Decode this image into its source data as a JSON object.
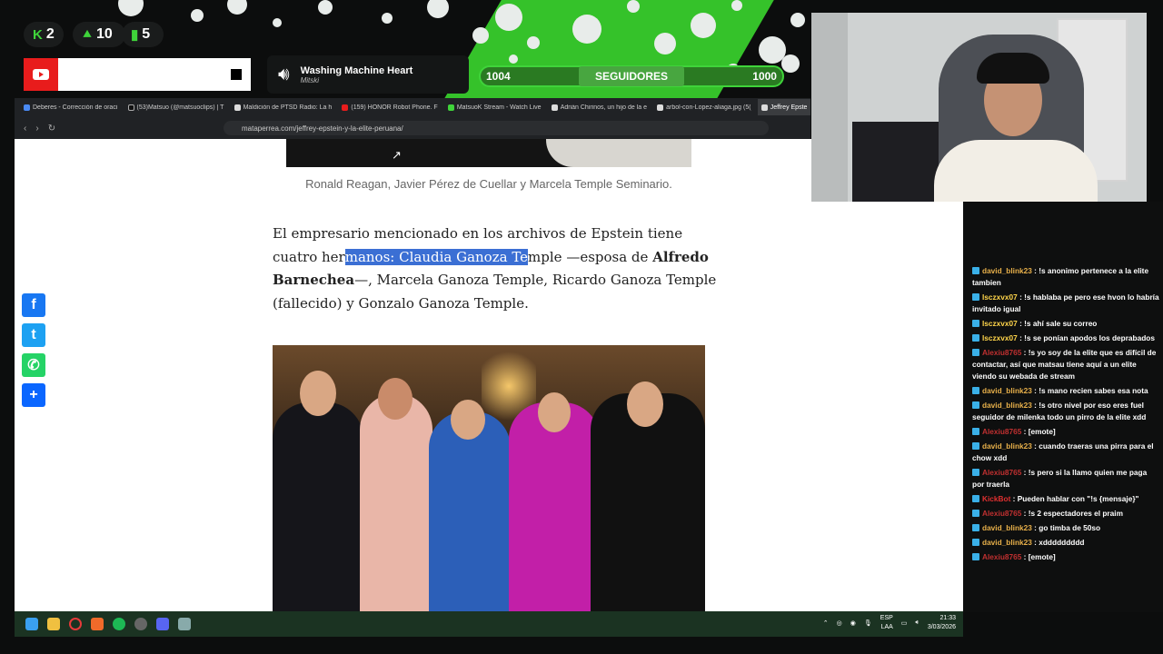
{
  "overlay": {
    "stats": [
      {
        "icon": "kick-icon",
        "value": "2"
      },
      {
        "icon": "follower-icon",
        "value": "10"
      },
      {
        "icon": "bars-icon",
        "value": "5"
      }
    ],
    "music": {
      "title": "Washing Machine Heart",
      "artist": "Mitski"
    },
    "followers": {
      "left": "1004",
      "label": "SEGUIDORES",
      "right": "1000"
    }
  },
  "browser": {
    "tabs": [
      "Deberes - Corrección de oraci",
      "(53)Matsuo (@matsuoclips) | T",
      "Maldición de PTSD Radio: La h",
      "(159) HONOR Robot Phone. F",
      "MatsuoK Stream - Watch Live",
      "Adrián Chirinos, un hijo de la e",
      "arbol-con-Lopez-aliaga.jpg (5(",
      "Jeffrey Epste"
    ],
    "url": "mataperrea.com/jeffrey-epstein-y-la-elite-peruana/"
  },
  "article": {
    "caption": "Ronald Reagan, Javier Pérez de Cuellar y Marcela Temple Seminario.",
    "p1": "El empresario mencionado en los archivos de Epstein tiene cuatro her",
    "p_hl": "manos: Claudia Ganoza Te",
    "p2": "mple —esposa de ",
    "p_bold": "Alfredo Barnechea",
    "p3": "—, Marcela Ganoza Temple, Ricardo Ganoza Temple (fallecido) y Gonzalo Ganoza Temple."
  },
  "chat": [
    {
      "user": "david_blink23",
      "cls": "u1",
      "text": "!s anonimo pertenece a la elite tambien"
    },
    {
      "user": "lsczxvx07",
      "cls": "u2",
      "text": "!s hablaba pe pero ese hvon lo habría invitado igual"
    },
    {
      "user": "lsczxvx07",
      "cls": "u2",
      "text": "!s ahí sale su correo"
    },
    {
      "user": "lsczxvx07",
      "cls": "u2",
      "text": "!s se ponían apodos los deprabados"
    },
    {
      "user": "Alexiu8765",
      "cls": "u3",
      "text": "!s yo soy de la elite que es difícil de contactar, así que matsau tiene aquí a un elite viendo su webada de stream"
    },
    {
      "user": "david_blink23",
      "cls": "u1",
      "text": "!s mano recien sabes esa nota"
    },
    {
      "user": "david_blink23",
      "cls": "u1",
      "text": "!s otro nivel por eso eres fuel seguidor de milenka todo un pirro de la elite xdd"
    },
    {
      "user": "Alexiu8765",
      "cls": "u3",
      "text": "[emote]"
    },
    {
      "user": "david_blink23",
      "cls": "u1",
      "text": "cuando traeras una pirra para el chow xdd"
    },
    {
      "user": "Alexiu8765",
      "cls": "u3",
      "text": "!s pero si la llamo quien me paga por traerla"
    },
    {
      "user": "KickBot",
      "cls": "u4",
      "text": "Pueden hablar con \"!s {mensaje}\""
    },
    {
      "user": "Alexiu8765",
      "cls": "u3",
      "text": "!s 2 espectadores el praim"
    },
    {
      "user": "david_blink23",
      "cls": "u1",
      "text": "go timba de 50so"
    },
    {
      "user": "david_blink23",
      "cls": "u1",
      "text": "xddddddddd"
    },
    {
      "user": "Alexiu8765",
      "cls": "u3",
      "text": "[emote]"
    }
  ],
  "taskbar": {
    "lang1": "ESP",
    "lang2": "LAA",
    "time": "21:33",
    "date": "3/03/2026"
  },
  "social": [
    "Facebook",
    "Twitter",
    "WhatsApp",
    "Share"
  ],
  "colors": {
    "accent_green": "#3fd43a",
    "youtube_red": "#e81c1c",
    "highlight": "#3b6fd4"
  }
}
